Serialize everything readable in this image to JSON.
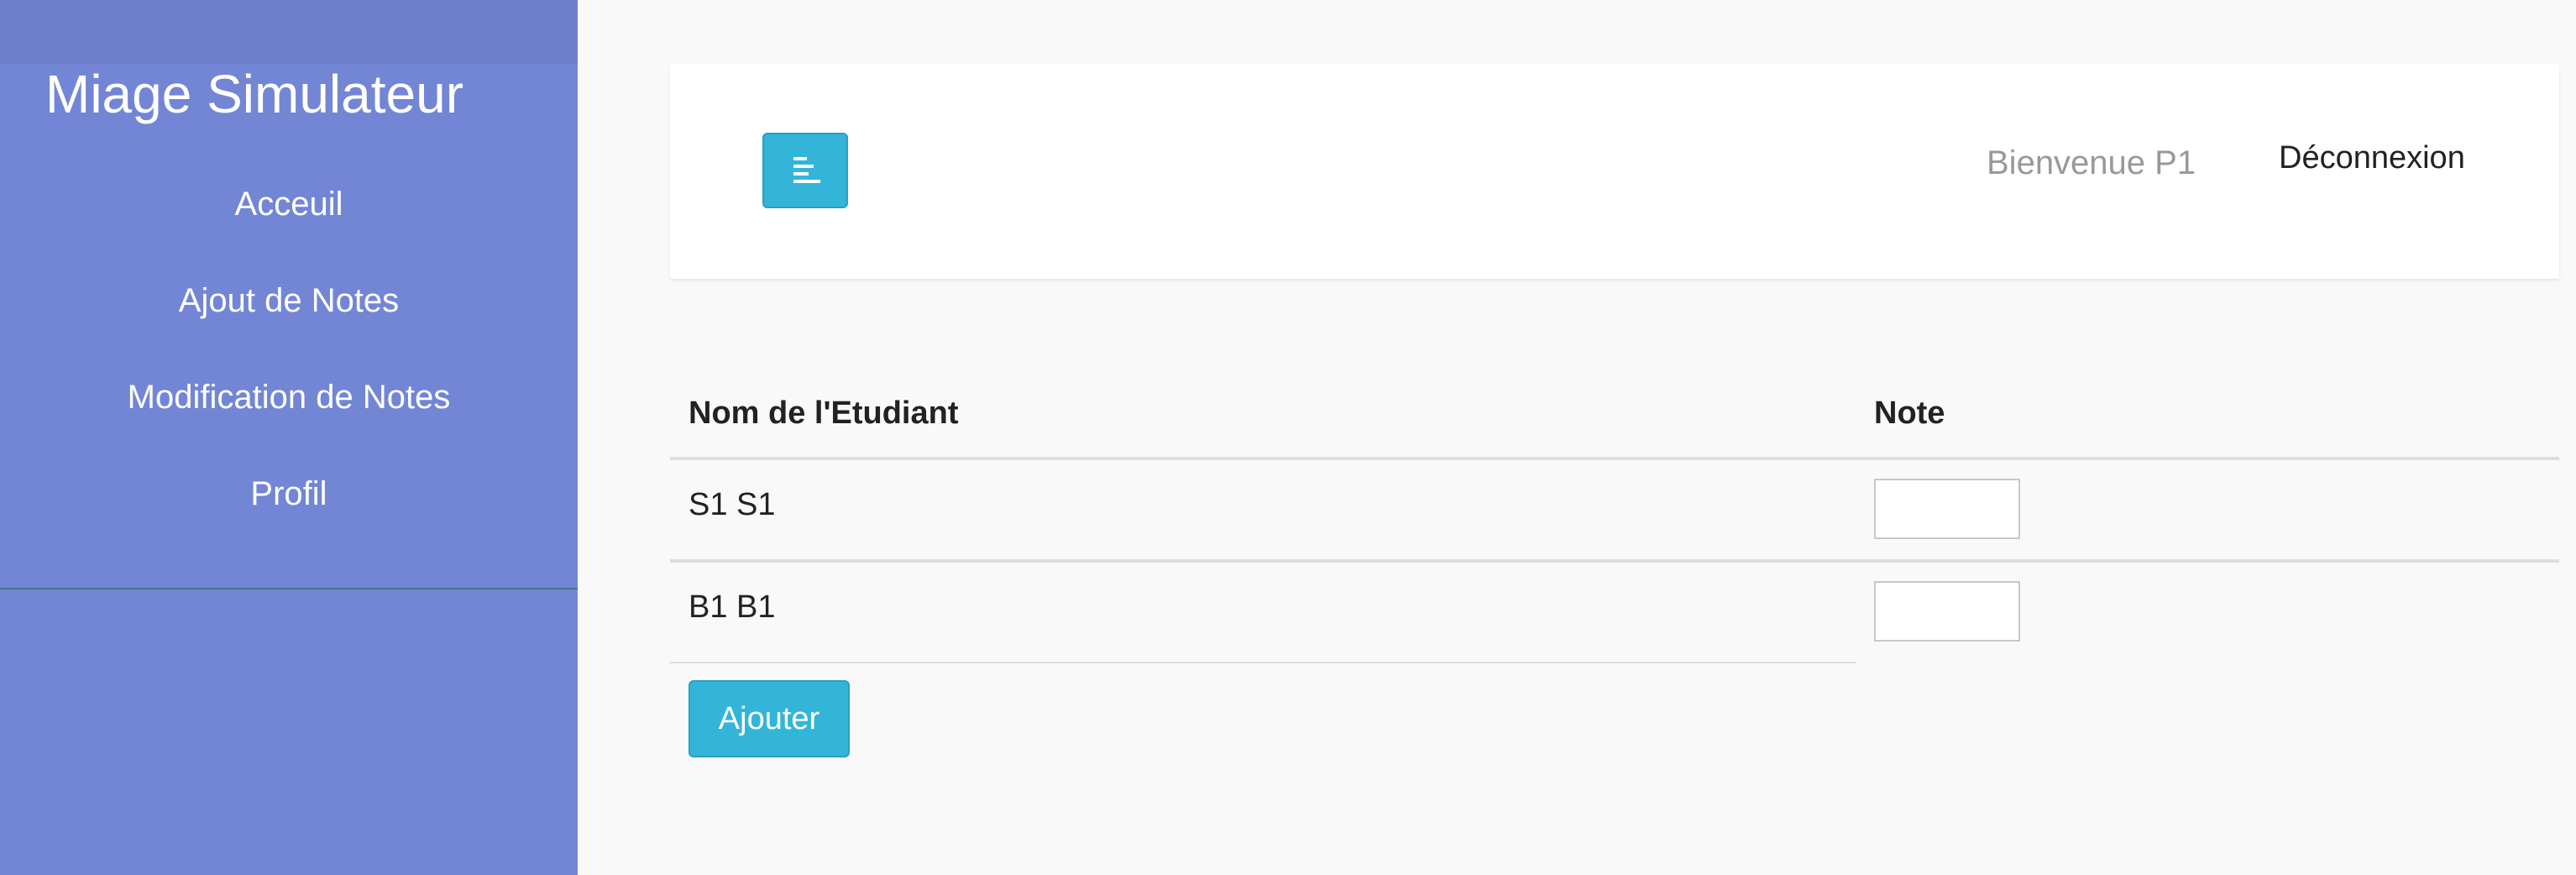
{
  "sidebar": {
    "brand": "Miage Simulateur",
    "items": [
      {
        "label": "Acceuil"
      },
      {
        "label": "Ajout de Notes"
      },
      {
        "label": "Modification de Notes"
      },
      {
        "label": "Profil"
      }
    ]
  },
  "topbar": {
    "toggle_icon": "align-left-icon",
    "welcome": "Bienvenue P1",
    "logout": "Déconnexion"
  },
  "table": {
    "headers": {
      "name": "Nom de l'Etudiant",
      "note": "Note"
    },
    "rows": [
      {
        "name": "S1 S1",
        "note": ""
      },
      {
        "name": "B1 B1",
        "note": ""
      }
    ]
  },
  "actions": {
    "add_label": "Ajouter"
  },
  "colors": {
    "sidebar": "#7386d5",
    "button": "#33b5d9",
    "background": "#f9f9f9"
  }
}
